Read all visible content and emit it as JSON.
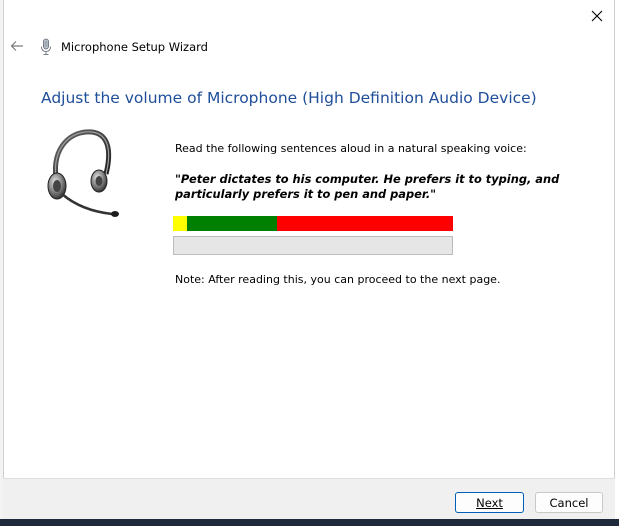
{
  "window": {
    "title": "Microphone Setup Wizard",
    "heading": "Adjust the volume of Microphone (High Definition Audio Device)"
  },
  "content": {
    "instructions": "Read the following sentences aloud in a natural speaking voice:",
    "quote": "\"Peter dictates to his computer. He prefers it to typing, and particularly prefers it to pen and paper.\"",
    "note": "Note: After reading this, you can proceed to the next page."
  },
  "meter": {
    "segments": [
      {
        "name": "low",
        "color": "#ffff00",
        "fraction": 0.05
      },
      {
        "name": "good",
        "color": "#008000",
        "fraction": 0.32
      },
      {
        "name": "high",
        "color": "#ff0000",
        "fraction": 0.63
      }
    ]
  },
  "progress": {
    "value": 0
  },
  "buttons": {
    "next": "Next",
    "cancel": "Cancel"
  },
  "colors": {
    "heading": "#1f4e9a",
    "accent": "#005fb8"
  },
  "icons": {
    "close": "close-icon",
    "back": "back-arrow-icon",
    "microphone": "microphone-icon",
    "headset": "headset-icon"
  }
}
